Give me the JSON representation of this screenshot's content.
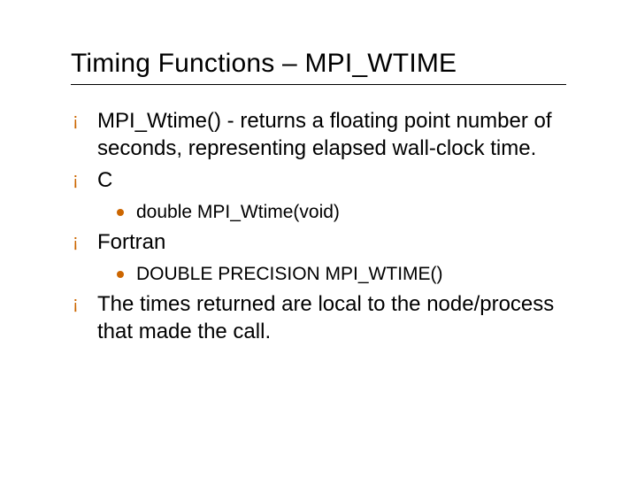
{
  "title": "Timing Functions – MPI_WTIME",
  "bullets": {
    "b0": "MPI_Wtime() - returns a floating point number of seconds, representing elapsed wall-clock time.",
    "b1": "C",
    "b1_sub0": "double MPI_Wtime(void)",
    "b2": "Fortran",
    "b2_sub0": "DOUBLE PRECISION MPI_WTIME()",
    "b3": "The times returned are local to the node/process that made the call."
  }
}
